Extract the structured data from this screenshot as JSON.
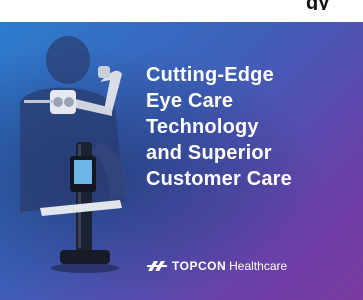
{
  "headline_lines": [
    "Cutting-Edge",
    "Eye Care",
    "Technology",
    "and Superior",
    "Customer Care"
  ],
  "brand": {
    "name": "TOPCON",
    "suffix": "Healthcare",
    "logo_icon": "topcon-logo-mark-icon"
  },
  "top_text_fragment": "gy",
  "colors": {
    "gradient_start": "#2a7fcf",
    "gradient_end": "#7a3aa0",
    "text": "#ffffff"
  }
}
